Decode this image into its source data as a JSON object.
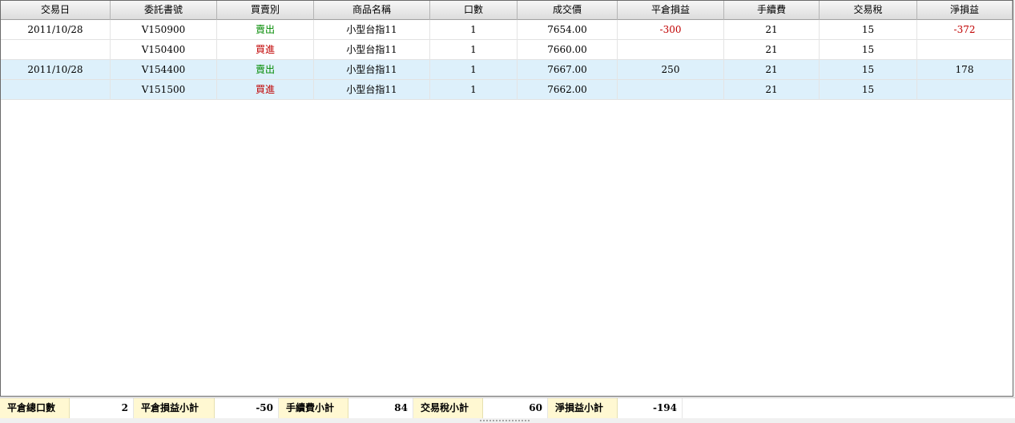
{
  "columns": [
    "交易日",
    "委託書號",
    "買賣別",
    "商品名稱",
    "口數",
    "成交價",
    "平倉損益",
    "手續費",
    "交易稅",
    "淨損益"
  ],
  "rows": [
    {
      "date": "2011/10/28",
      "order_no": "V150900",
      "side": "賣出",
      "side_type": "sell",
      "product": "小型台指11",
      "qty": "1",
      "price": "7654.00",
      "pnl": "-300",
      "fee": "21",
      "tax": "15",
      "net": "-372"
    },
    {
      "date": "",
      "order_no": "V150400",
      "side": "買進",
      "side_type": "buy",
      "product": "小型台指11",
      "qty": "1",
      "price": "7660.00",
      "pnl": "",
      "fee": "21",
      "tax": "15",
      "net": ""
    },
    {
      "date": "2011/10/28",
      "order_no": "V154400",
      "side": "賣出",
      "side_type": "sell",
      "product": "小型台指11",
      "qty": "1",
      "price": "7667.00",
      "pnl": "250",
      "fee": "21",
      "tax": "15",
      "net": "178"
    },
    {
      "date": "",
      "order_no": "V151500",
      "side": "買進",
      "side_type": "buy",
      "product": "小型台指11",
      "qty": "1",
      "price": "7662.00",
      "pnl": "",
      "fee": "21",
      "tax": "15",
      "net": ""
    }
  ],
  "summary": {
    "total_close_qty_label": "平倉總口數",
    "total_close_qty": "2",
    "pnl_subtotal_label": "平倉損益小計",
    "pnl_subtotal": "-50",
    "fee_subtotal_label": "手續費小計",
    "fee_subtotal": "84",
    "tax_subtotal_label": "交易稅小計",
    "tax_subtotal": "60",
    "net_subtotal_label": "淨損益小計",
    "net_subtotal": "-194"
  },
  "colors": {
    "sell": "#008a00",
    "buy": "#c00000",
    "negative": "#c00000",
    "alt_row": "#ddf0fb",
    "summary_label_bg": "#fff8d2"
  }
}
